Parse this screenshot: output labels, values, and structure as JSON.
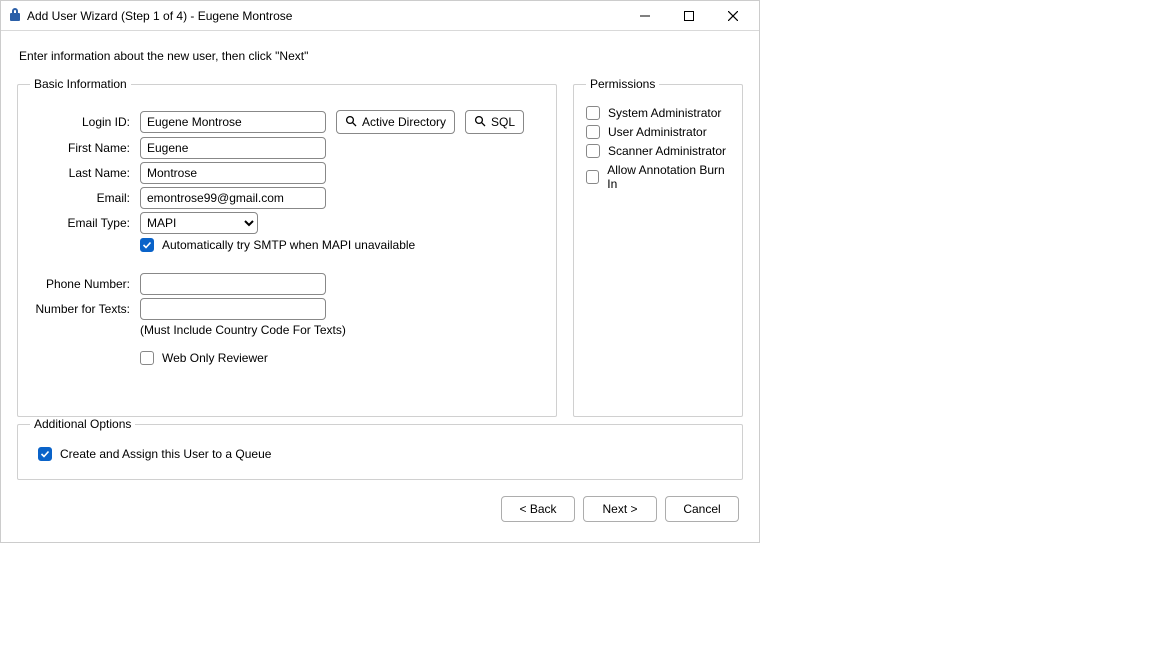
{
  "window": {
    "title": "Add User Wizard (Step 1 of 4) - Eugene Montrose"
  },
  "instruction": "Enter information about the new user, then click \"Next\"",
  "basic": {
    "legend": "Basic Information",
    "labels": {
      "login_id": "Login ID:",
      "first_name": "First Name:",
      "last_name": "Last Name:",
      "email": "Email:",
      "email_type": "Email Type:",
      "phone": "Phone Number:",
      "texts": "Number for Texts:"
    },
    "values": {
      "login_id": "Eugene Montrose",
      "first_name": "Eugene",
      "last_name": "Montrose",
      "email": "emontrose99@gmail.com",
      "email_type": "MAPI",
      "phone": "",
      "texts": ""
    },
    "buttons": {
      "ad": "Active Directory",
      "sql": "SQL"
    },
    "smtp_fallback_label": "Automatically try SMTP when MAPI unavailable",
    "smtp_fallback_checked": true,
    "texts_hint": "(Must Include Country Code For Texts)",
    "web_only_label": "Web Only Reviewer",
    "web_only_checked": false
  },
  "permissions": {
    "legend": "Permissions",
    "items": [
      {
        "label": "System Administrator",
        "checked": false
      },
      {
        "label": "User Administrator",
        "checked": false
      },
      {
        "label": "Scanner Administrator",
        "checked": false
      },
      {
        "label": "Allow Annotation Burn In",
        "checked": false
      }
    ]
  },
  "additional": {
    "legend": "Additional Options",
    "assign_queue_label": "Create and Assign this User to a Queue",
    "assign_queue_checked": true
  },
  "footer": {
    "back": "< Back",
    "next": "Next >",
    "cancel": "Cancel"
  }
}
